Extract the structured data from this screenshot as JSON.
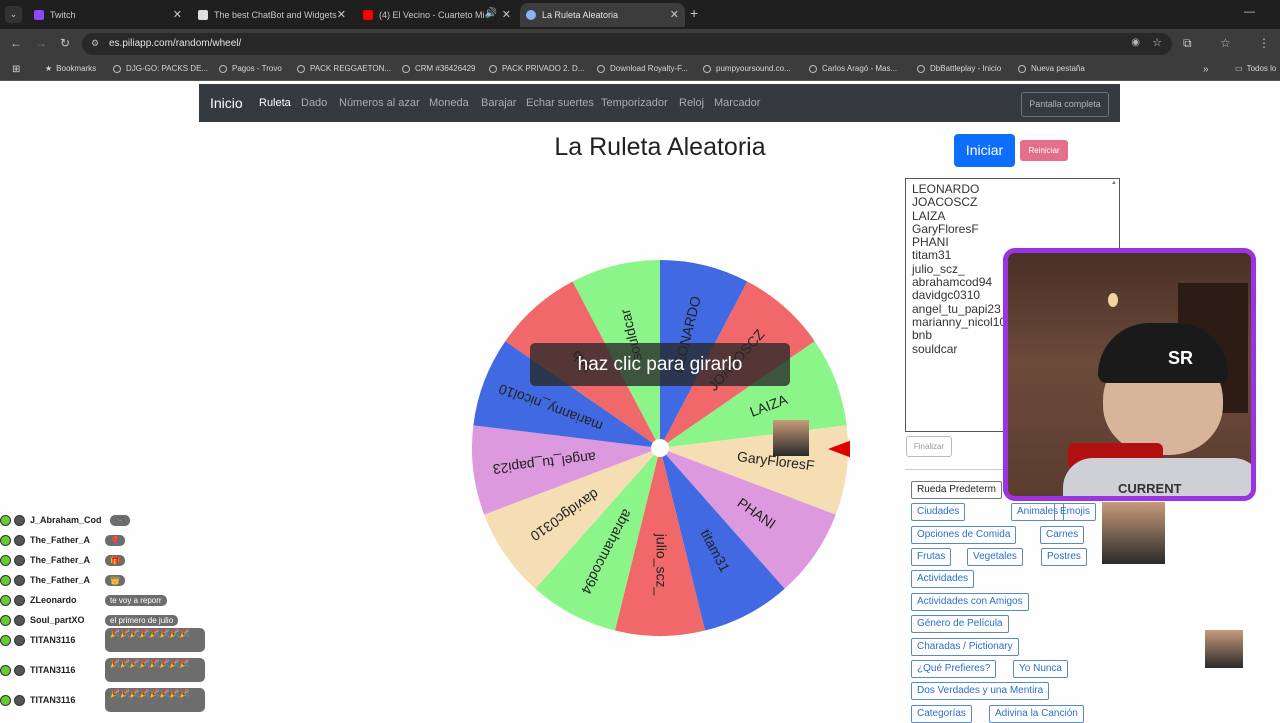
{
  "browser": {
    "tabs": [
      {
        "title": "Twitch",
        "color": "#9146ff"
      },
      {
        "title": "The best ChatBot and Widgets",
        "color": "#ffffff"
      },
      {
        "title": "(4) El Vecino - Cuarteto Mi",
        "color": "#ff0000"
      },
      {
        "title": "La Ruleta Aleatoria",
        "color": "#8ab4f8"
      }
    ],
    "url": "es.piliapp.com/random/wheel/",
    "bookmarks": [
      "Bookmarks",
      "DJG-GO: PACKS DE...",
      "Pagos - Trovo",
      "PACK REGGAETON...",
      "CRM #36426429",
      "PACK PRIVADO 2. D...",
      "Download Royalty-F...",
      "pumpyoursound.co...",
      "Carlos Aragó - Mas...",
      "DbBattleplay - Inicio",
      "Nueva pestaña"
    ],
    "all_bookmarks": "Todos lo"
  },
  "nav": {
    "brand": "Inicio",
    "items": [
      "Ruleta",
      "Dado",
      "Números al azar",
      "Moneda",
      "Barajar",
      "Echar suertes",
      "Temporizador",
      "Reloj",
      "Marcador"
    ],
    "fullscreen": "Pantalla completa"
  },
  "page": {
    "title": "La Ruleta Aleatoria",
    "start": "Iniciar",
    "reset": "Reiniciar",
    "click_hint": "haz clic para girarlo",
    "finish": "Finalizar"
  },
  "wheel": {
    "segments": [
      {
        "label": "LEONARDO",
        "color": "#4169e1"
      },
      {
        "label": "JOACOSCZ",
        "color": "#f0686a"
      },
      {
        "label": "LAIZA",
        "color": "#8cf58a"
      },
      {
        "label": "GaryFloresF",
        "color": "#f5deb3"
      },
      {
        "label": "PHANI",
        "color": "#dd99dd"
      },
      {
        "label": "titam31",
        "color": "#4169e1"
      },
      {
        "label": "julio_scz_",
        "color": "#f0686a"
      },
      {
        "label": "abrahamcod94",
        "color": "#8cf58a"
      },
      {
        "label": "davidgc0310",
        "color": "#f5deb3"
      },
      {
        "label": "angel_tu_papi23",
        "color": "#dd99dd"
      },
      {
        "label": "marianny_nicol10",
        "color": "#4169e1"
      },
      {
        "label": "bnb",
        "color": "#f0686a"
      },
      {
        "label": "souldcar",
        "color": "#8cf58a"
      }
    ],
    "pointer_color": "#e00000"
  },
  "names_list": [
    "LEONARDO",
    "JOACOSCZ",
    "LAIZA",
    "GaryFloresF",
    "PHANI",
    "titam31",
    "julio_scz_",
    "abrahamcod94",
    "davidgc0310",
    "angel_tu_papi23",
    "marianny_nicol10",
    "bnb",
    "souldcar"
  ],
  "presets": [
    "Rueda Predeterm",
    "Ciudades",
    "Animales",
    "Emojis",
    "Opciones de Comida",
    "Carnes",
    "Frutas",
    "Vegetales",
    "Postres",
    "Actividades",
    "Actividades con Amigos",
    "Género de Película",
    "Charadas / Pictionary",
    "¿Qué Prefieres?",
    "Yo Nunca",
    "Dos Verdades y una Mentira",
    "Categorías",
    "Adivina la Canción"
  ],
  "webcam": {
    "cap_logo": "SR",
    "shirt_text": "CURRENT"
  },
  "chat": [
    {
      "user": "J_Abraham_Cod",
      "msg": "🎮"
    },
    {
      "user": "The_Father_A",
      "msg": "🎈"
    },
    {
      "user": "The_Father_A",
      "msg": "🎁"
    },
    {
      "user": "The_Father_A",
      "msg": "👑"
    },
    {
      "user": "ZLeonardo",
      "msg": "te voy a reporr"
    },
    {
      "user": "Soul_partXO",
      "msg": "el primero de julio"
    },
    {
      "user": "TITAN3116",
      "msg": "🎉🎉🎉🎉🎉🎉🎉🎉"
    },
    {
      "user": "TITAN3116",
      "msg": "🎉🎉🎉🎉🎉🎉🎉🎉"
    },
    {
      "user": "TITAN3116",
      "msg": "🎉🎉🎉🎉🎉🎉🎉🎉"
    }
  ]
}
